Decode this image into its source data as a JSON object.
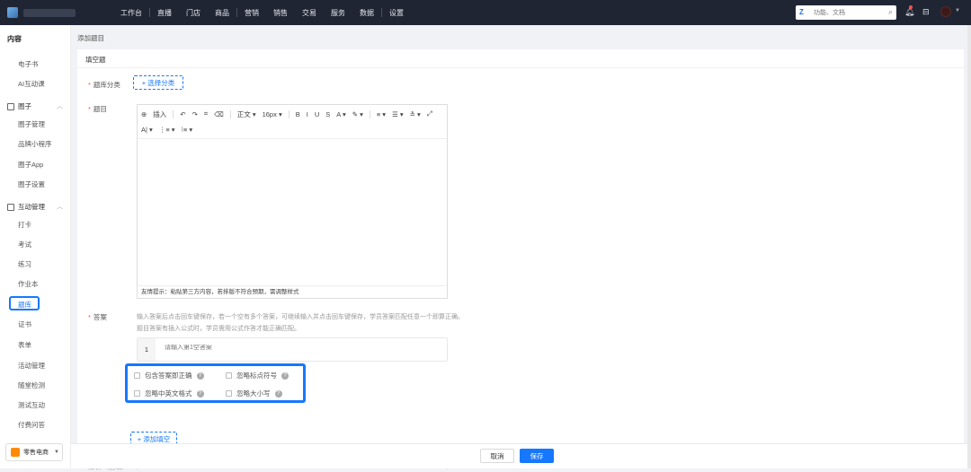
{
  "topbar": {
    "nav": [
      "工作台",
      "直播",
      "门店",
      "商品",
      "营销",
      "销售",
      "交易",
      "服务",
      "数据",
      "设置"
    ],
    "search_placeholder": "功能、文档",
    "search_logo": "Z"
  },
  "sidebar": {
    "title": "内容",
    "top_items": [
      "电子书",
      "AI互动课"
    ],
    "group_circle": "圈子",
    "circle_items": [
      "圈子管理",
      "品牌小程序",
      "圈子App",
      "圈子设置"
    ],
    "group_interact": "互动管理",
    "interact_items_before": [
      "打卡",
      "考试",
      "练习",
      "作业本"
    ],
    "active_item": "题库",
    "interact_items_after": [
      "证书",
      "表单",
      "活动管理",
      "随堂检测",
      "测试互动",
      "付费问答"
    ],
    "store_label": "零售电商"
  },
  "page": {
    "breadcrumb": "添加题目",
    "card_title": "填空题",
    "category_label": "题库分类",
    "category_button": "+ 选择分类",
    "question_label": "题目",
    "editor": {
      "row1": [
        "⊕",
        "插入",
        "↶",
        "↷",
        "⌗",
        "⌫",
        "正文 ▾",
        "16px ▾",
        "B",
        "I",
        "U",
        "S",
        "A ▾",
        "✎ ▾",
        "≡ ▾",
        "☰ ▾",
        "≛ ▾",
        "⤢"
      ],
      "row2": [
        "A| ▾",
        "⋮≡ ▾",
        "⁝≡ ▾"
      ],
      "footer": "友情提示：粘贴第三方内容，若排版不符合预期，需调整样式"
    },
    "answer_label": "答案",
    "answer_hint_1": "输入答案后点击回车键保存，若一个空有多个答案，可继续输入并点击回车键保存，学员答案匹配任意一个即算正确。",
    "answer_hint_2": "题目答案有插入公式时，学员需用公式作答才能正确匹配。",
    "answer_row": {
      "index": "1",
      "placeholder": "请输入第1空答案"
    },
    "options": [
      "包含答案即正确",
      "忽略标点符号",
      "忽略中英文格式",
      "忽略大小写"
    ],
    "add_blank_button": "+ 添加填空",
    "next_label": "解析（选填）"
  },
  "footer": {
    "cancel": "取消",
    "save": "保存"
  },
  "colors": {
    "accent": "#1677ff",
    "topbar": "#1f2533",
    "required": "#ff4d4f"
  }
}
